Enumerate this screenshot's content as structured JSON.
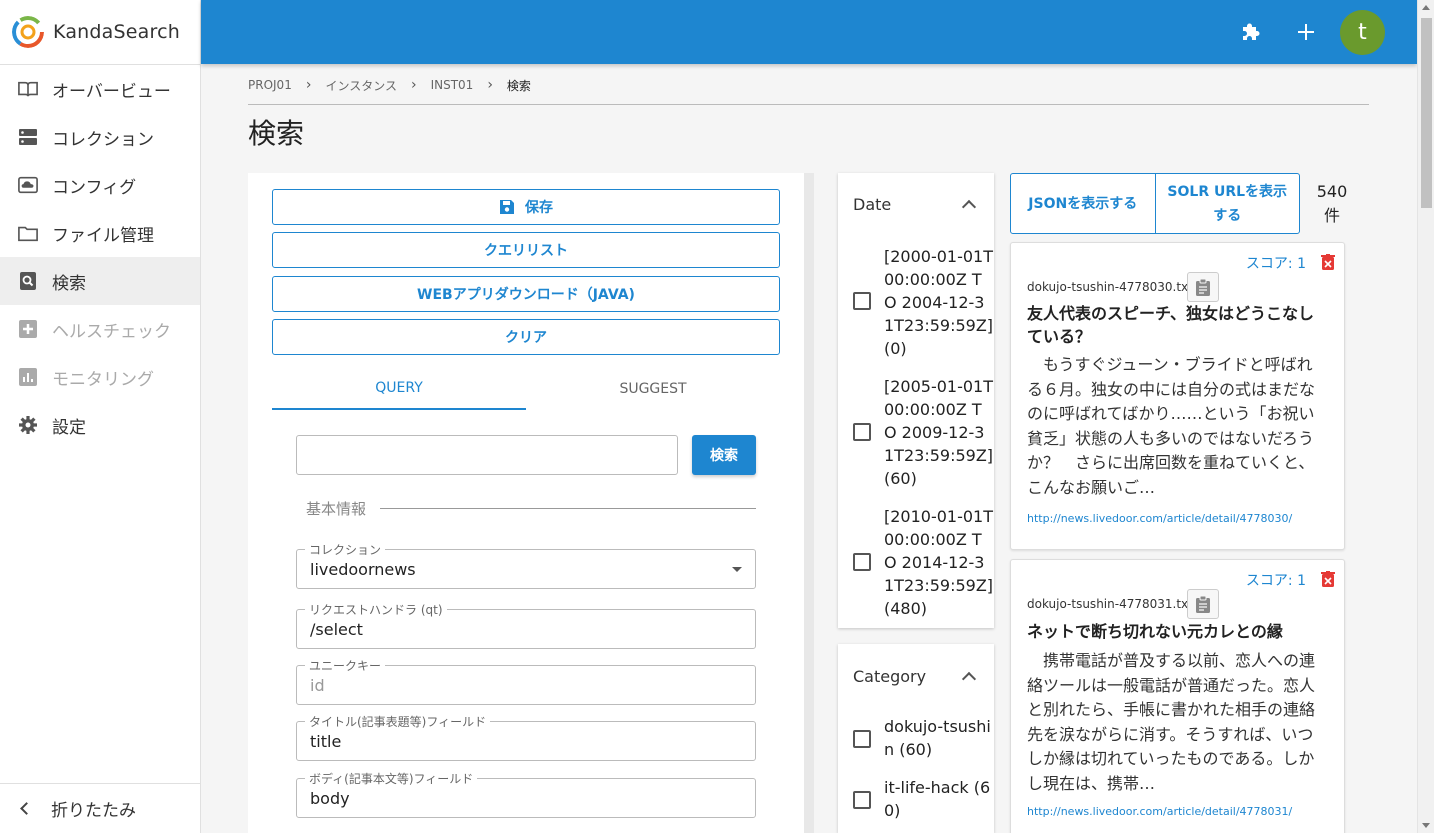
{
  "app": {
    "name": "KandaSearch",
    "user_initial": "t",
    "brand_color": "#1e86d0"
  },
  "sidebar": {
    "items": [
      {
        "label": "オーバービュー",
        "icon": "book-icon"
      },
      {
        "label": "コレクション",
        "icon": "storage-icon"
      },
      {
        "label": "コンフィグ",
        "icon": "cloud-config-icon"
      },
      {
        "label": "ファイル管理",
        "icon": "folder-icon"
      },
      {
        "label": "検索",
        "icon": "search-doc-icon",
        "active": true
      },
      {
        "label": "ヘルスチェック",
        "icon": "plus-box-icon",
        "disabled": true
      },
      {
        "label": "モニタリング",
        "icon": "chart-icon",
        "disabled": true
      },
      {
        "label": "設定",
        "icon": "gear-icon"
      }
    ],
    "collapse_label": "折りたたみ"
  },
  "breadcrumb": [
    "PROJ01",
    "インスタンス",
    "INST01",
    "検索"
  ],
  "page_title": "検索",
  "actions": {
    "save": "保存",
    "query_list": "クエリリスト",
    "webapp_download": "WEBアプリダウンロード（JAVA)",
    "clear": "クリア"
  },
  "tabs": [
    "QUERY",
    "SUGGEST"
  ],
  "search": {
    "value": "",
    "button": "検索"
  },
  "basic_info": {
    "section_label": "基本情報",
    "fields": [
      {
        "label": "コレクション",
        "value": "livedoornews",
        "type": "select"
      },
      {
        "label": "リクエストハンドラ (qt)",
        "value": "/select"
      },
      {
        "label": "ユニークキー",
        "value": "",
        "placeholder": "id"
      },
      {
        "label": "タイトル(記事表題等)フィールド",
        "value": "title"
      },
      {
        "label": "ボディ(記事本文等)フィールド",
        "value": "body"
      }
    ]
  },
  "facets": [
    {
      "name": "Date",
      "items": [
        "[2000-01-01T00:00:00Z TO 2004-12-31T23:59:59Z] (0)",
        "[2005-01-01T00:00:00Z TO 2009-12-31T23:59:59Z] (60)",
        "[2010-01-01T00:00:00Z TO 2014-12-31T23:59:59Z] (480)"
      ]
    },
    {
      "name": "Category",
      "items": [
        "dokujo-tsushin (60)",
        "it-life-hack (60)"
      ]
    }
  ],
  "results": {
    "show_json": "JSONを表示する",
    "show_solr_url": "SOLR URLを表示する",
    "count_label": "540件",
    "items": [
      {
        "score": "スコア: 1",
        "file": "dokujo-tsushin-4778030.txt",
        "title": "友人代表のスピーチ、独女はどうこなしている？",
        "snippet": "　もうすぐジューン・ブライドと呼ばれる６月。独女の中には自分の式はまだなのに呼ばれてばかり……という「お祝い貧乏」状態の人も多いのではないだろうか？　さらに出席回数を重ねていくと、こんなお願いご…",
        "url": "http://news.livedoor.com/article/detail/4778030/"
      },
      {
        "score": "スコア: 1",
        "file": "dokujo-tsushin-4778031.txt",
        "title": "ネットで断ち切れない元カレとの縁",
        "snippet": "　携帯電話が普及する以前、恋人への連絡ツールは一般電話が普通だった。恋人と別れたら、手帳に書かれた相手の連絡先を涙ながらに消す。そうすれば、いつしか縁は切れていったものである。しかし現在は、携帯…",
        "url": "http://news.livedoor.com/article/detail/4778031/"
      }
    ]
  }
}
